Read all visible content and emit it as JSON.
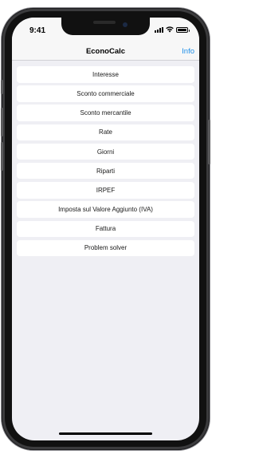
{
  "status_bar": {
    "time": "9:41",
    "icons": [
      "cellular-signal-icon",
      "wifi-icon",
      "battery-icon"
    ]
  },
  "nav": {
    "title": "EconoCalc",
    "info_label": "Info",
    "accent_color": "#1e8fe8"
  },
  "menu": {
    "items": [
      {
        "label": "Interesse"
      },
      {
        "label": "Sconto commerciale"
      },
      {
        "label": "Sconto mercantile"
      },
      {
        "label": "Rate"
      },
      {
        "label": "Giorni"
      },
      {
        "label": "Riparti"
      },
      {
        "label": "IRPEF"
      },
      {
        "label": "Imposta sul Valore Aggiunto (IVA)"
      },
      {
        "label": "Fattura"
      },
      {
        "label": "Problem solver"
      }
    ]
  }
}
